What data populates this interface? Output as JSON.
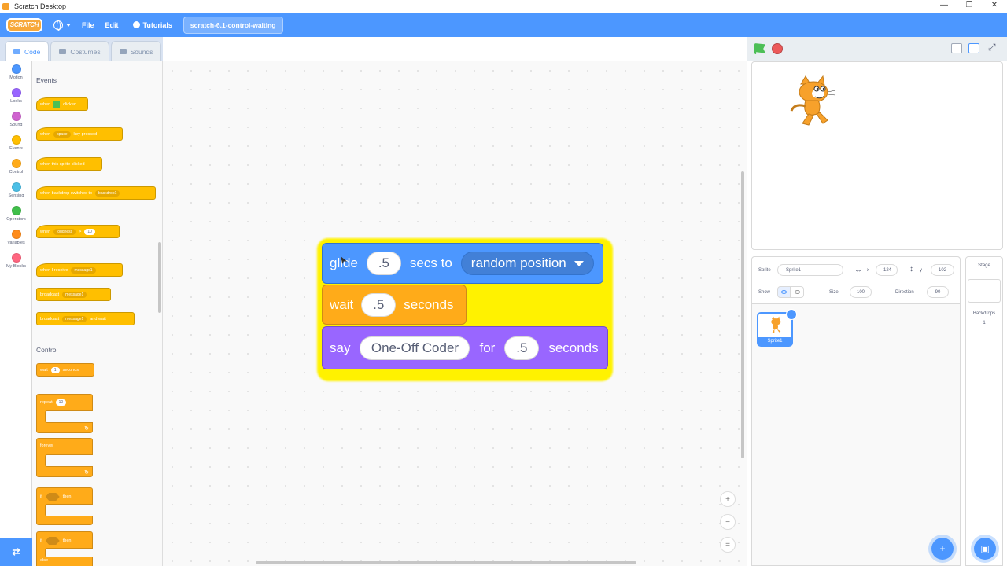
{
  "window": {
    "title": "Scratch Desktop",
    "controls": [
      "—",
      "❐",
      "✕"
    ]
  },
  "menubar": {
    "logo": "SCRATCH",
    "file": "File",
    "edit": "Edit",
    "tutorials": "Tutorials",
    "project_title": "scratch-6.1-control-waiting"
  },
  "tabs": {
    "code": "Code",
    "costumes": "Costumes",
    "sounds": "Sounds"
  },
  "categories": [
    {
      "label": "Motion",
      "color": "#4c97ff"
    },
    {
      "label": "Looks",
      "color": "#9966ff"
    },
    {
      "label": "Sound",
      "color": "#cf63cf"
    },
    {
      "label": "Events",
      "color": "#ffbf00"
    },
    {
      "label": "Control",
      "color": "#ffab19"
    },
    {
      "label": "Sensing",
      "color": "#4cbfe6"
    },
    {
      "label": "Operators",
      "color": "#40bf4a"
    },
    {
      "label": "Variables",
      "color": "#ff8c1a"
    },
    {
      "label": "My Blocks",
      "color": "#ff6680"
    }
  ],
  "palette": {
    "events_head": "Events",
    "control_head": "Control",
    "when_flag": {
      "a": "when",
      "b": "clicked"
    },
    "when_key": {
      "a": "when",
      "key": "space",
      "b": "key pressed"
    },
    "when_sprite": "when this sprite clicked",
    "when_backdrop": {
      "a": "when backdrop switches to",
      "opt": "backdrop1"
    },
    "when_loud": {
      "a": "when",
      "opt": "loudness",
      "op": ">",
      "val": "10"
    },
    "when_receive": {
      "a": "when I receive",
      "opt": "message1"
    },
    "broadcast": {
      "a": "broadcast",
      "opt": "message1"
    },
    "broadcast_wait": {
      "a": "broadcast",
      "opt": "message1",
      "b": "and wait"
    },
    "wait": {
      "a": "wait",
      "val": "1",
      "b": "seconds"
    },
    "repeat": {
      "a": "repeat",
      "val": "10"
    },
    "forever": "forever",
    "if_then": {
      "a": "if",
      "b": "then"
    },
    "if_else": {
      "a": "if",
      "b": "then",
      "c": "else"
    }
  },
  "script": {
    "glide": {
      "a": "glide",
      "val": ".5",
      "b": "secs to",
      "opt": "random position"
    },
    "wait": {
      "a": "wait",
      "val": ".5",
      "b": "seconds"
    },
    "say": {
      "a": "say",
      "msg": "One-Off Coder",
      "b": "for",
      "val": ".5",
      "c": "seconds"
    }
  },
  "zoom": {
    "in": "+",
    "out": "−",
    "reset": "="
  },
  "sprite_info": {
    "sprite_label": "Sprite",
    "sprite_name": "Sprite1",
    "x_label": "x",
    "x_value": "-124",
    "y_label": "y",
    "y_value": "102",
    "show_label": "Show",
    "size_label": "Size",
    "size_value": "100",
    "direction_label": "Direction",
    "direction_value": "90"
  },
  "sprites": [
    {
      "name": "Sprite1"
    }
  ],
  "stage_panel": {
    "title": "Stage",
    "backdrops_label": "Backdrops",
    "backdrops_count": "1"
  },
  "colors": {
    "accent": "#4c97ff",
    "highlight": "#fff200"
  }
}
